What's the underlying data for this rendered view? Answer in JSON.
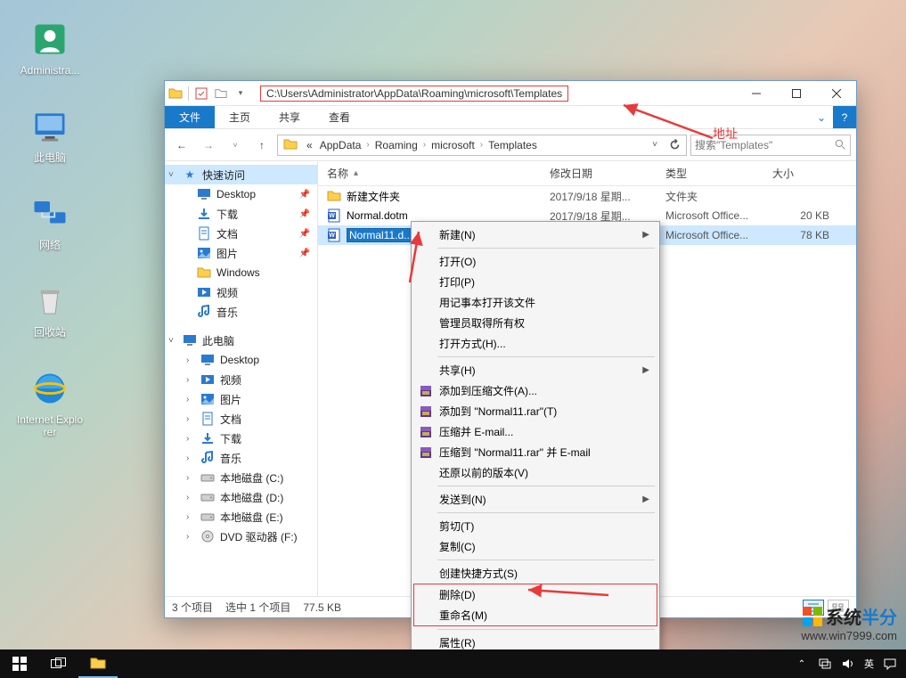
{
  "desktop": {
    "icons": [
      {
        "label": "Administra...",
        "kind": "user"
      },
      {
        "label": "此电脑",
        "kind": "pc"
      },
      {
        "label": "网络",
        "kind": "network"
      },
      {
        "label": "回收站",
        "kind": "recycle"
      },
      {
        "label": "Internet Explorer",
        "kind": "ie"
      }
    ]
  },
  "explorer": {
    "window_title": "C:\\Users\\Administrator\\AppData\\Roaming\\microsoft\\Templates",
    "ribbon": {
      "file": "文件",
      "home": "主页",
      "share": "共享",
      "view": "查看"
    },
    "breadcrumb": {
      "lead": "«",
      "items": [
        "AppData",
        "Roaming",
        "microsoft",
        "Templates"
      ]
    },
    "search_placeholder": "搜索\"Templates\"",
    "columns": {
      "name": "名称",
      "date": "修改日期",
      "type": "类型",
      "size": "大小"
    },
    "files": [
      {
        "name": "新建文件夹",
        "date": "2017/9/18 星期...",
        "type": "文件夹",
        "size": "",
        "kind": "folder"
      },
      {
        "name": "Normal.dotm",
        "date": "2017/9/18 星期...",
        "type": "Microsoft Office...",
        "size": "20 KB",
        "kind": "word"
      },
      {
        "name": "Normal11.d...",
        "date": "",
        "type": "Microsoft Office...",
        "size": "78 KB",
        "kind": "word",
        "selected": true
      }
    ],
    "status": {
      "count": "3 个项目",
      "selected": "选中 1 个项目",
      "size": "77.5 KB"
    }
  },
  "nav": {
    "quick_access": "快速访问",
    "qa_items": [
      {
        "label": "Desktop",
        "icon": "desktop",
        "pin": true
      },
      {
        "label": "下载",
        "icon": "download",
        "pin": true
      },
      {
        "label": "文档",
        "icon": "document",
        "pin": true
      },
      {
        "label": "图片",
        "icon": "picture",
        "pin": true
      },
      {
        "label": "Windows",
        "icon": "folder",
        "pin": false
      },
      {
        "label": "视频",
        "icon": "video",
        "pin": false
      },
      {
        "label": "音乐",
        "icon": "music",
        "pin": false
      }
    ],
    "this_pc": "此电脑",
    "pc_items": [
      {
        "label": "Desktop",
        "icon": "desktop"
      },
      {
        "label": "视频",
        "icon": "video"
      },
      {
        "label": "图片",
        "icon": "picture"
      },
      {
        "label": "文档",
        "icon": "document"
      },
      {
        "label": "下载",
        "icon": "download"
      },
      {
        "label": "音乐",
        "icon": "music"
      },
      {
        "label": "本地磁盘 (C:)",
        "icon": "drive"
      },
      {
        "label": "本地磁盘 (D:)",
        "icon": "drive"
      },
      {
        "label": "本地磁盘 (E:)",
        "icon": "drive"
      },
      {
        "label": "DVD 驱动器 (F:)",
        "icon": "dvd"
      }
    ]
  },
  "context_menu": {
    "items": [
      {
        "label": "新建(N)",
        "sub": true
      },
      {
        "sep": true
      },
      {
        "label": "打开(O)"
      },
      {
        "label": "打印(P)"
      },
      {
        "label": "用记事本打开该文件"
      },
      {
        "label": "管理员取得所有权"
      },
      {
        "label": "打开方式(H)..."
      },
      {
        "sep": true
      },
      {
        "label": "共享(H)",
        "sub": true
      },
      {
        "label": "添加到压缩文件(A)...",
        "icon": "rar"
      },
      {
        "label": "添加到 \"Normal11.rar\"(T)",
        "icon": "rar"
      },
      {
        "label": "压缩并 E-mail...",
        "icon": "rar"
      },
      {
        "label": "压缩到 \"Normal11.rar\" 并 E-mail",
        "icon": "rar"
      },
      {
        "label": "还原以前的版本(V)"
      },
      {
        "sep": true
      },
      {
        "label": "发送到(N)",
        "sub": true
      },
      {
        "sep": true
      },
      {
        "label": "剪切(T)"
      },
      {
        "label": "复制(C)"
      },
      {
        "sep": true
      },
      {
        "label": "创建快捷方式(S)"
      },
      {
        "label": "删除(D)",
        "group": "hot"
      },
      {
        "label": "重命名(M)",
        "group": "hot"
      },
      {
        "sep": true
      },
      {
        "label": "属性(R)"
      }
    ]
  },
  "annotations": {
    "address": "地址"
  },
  "watermark": {
    "brand_a": "系统",
    "brand_b": "半分",
    "url": "www.win7999.com"
  },
  "tray": {
    "ime": "英"
  }
}
